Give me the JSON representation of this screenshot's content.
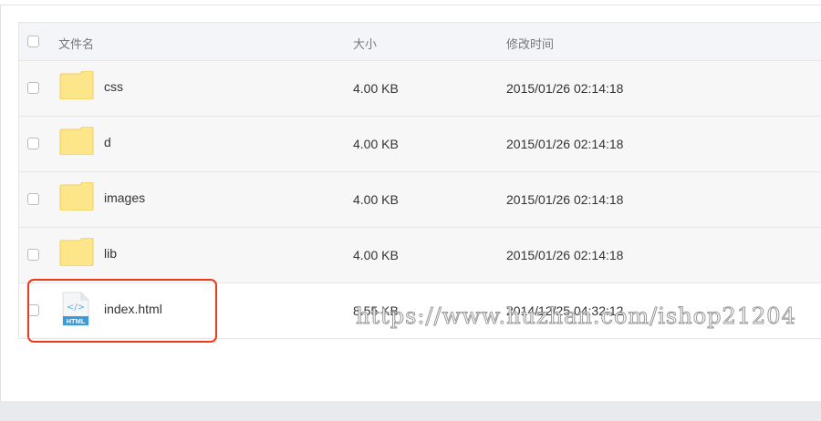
{
  "table": {
    "headers": {
      "name": "文件名",
      "size": "大小",
      "modified": "修改时间"
    },
    "rows": [
      {
        "icon": "folder-icon",
        "name": "css",
        "size": "4.00 KB",
        "modified": "2015/01/26 02:14:18"
      },
      {
        "icon": "folder-icon",
        "name": "d",
        "size": "4.00 KB",
        "modified": "2015/01/26 02:14:18"
      },
      {
        "icon": "folder-icon",
        "name": "images",
        "size": "4.00 KB",
        "modified": "2015/01/26 02:14:18"
      },
      {
        "icon": "folder-icon",
        "name": "lib",
        "size": "4.00 KB",
        "modified": "2015/01/26 02:14:18"
      },
      {
        "icon": "html-file-icon",
        "name": "index.html",
        "size": "8.55 KB",
        "modified": "2014/12/25 04:32:12",
        "file_badge": "HTML"
      }
    ]
  },
  "watermark": "https://www.huzhan.com/ishop21204",
  "colors": {
    "highlight": "#f03a17",
    "folder": "#fde58a",
    "html_icon": "#3b9ad9"
  }
}
